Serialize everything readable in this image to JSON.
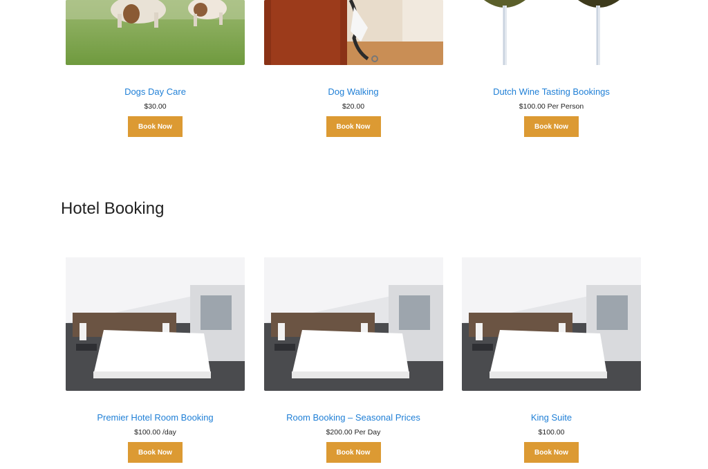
{
  "top_products": [
    {
      "title": "Dogs Day Care",
      "price": "$30.00",
      "button": "Book Now",
      "image": "dogs-on-grass"
    },
    {
      "title": "Dog Walking",
      "price": "$20.00",
      "button": "Book Now",
      "image": "leash-on-door"
    },
    {
      "title": "Dutch Wine Tasting Bookings",
      "price": "$100.00 Per Person",
      "button": "Book Now",
      "image": "wine-glasses"
    }
  ],
  "hotel_section": {
    "heading": "Hotel Booking",
    "products": [
      {
        "title": "Premier Hotel Room Booking",
        "price": "$100.00 /day",
        "button": "Book Now",
        "image": "hotel-room"
      },
      {
        "title": "Room Booking – Seasonal Prices",
        "price": "$200.00 Per Day",
        "button": "Book Now",
        "image": "hotel-room"
      },
      {
        "title": "King Suite",
        "price": "$100.00",
        "button": "Book Now",
        "image": "hotel-room"
      }
    ]
  },
  "colors": {
    "link": "#1f7fd6",
    "button": "#dc9a33",
    "button_text": "#ffffff",
    "heading": "#222222"
  }
}
